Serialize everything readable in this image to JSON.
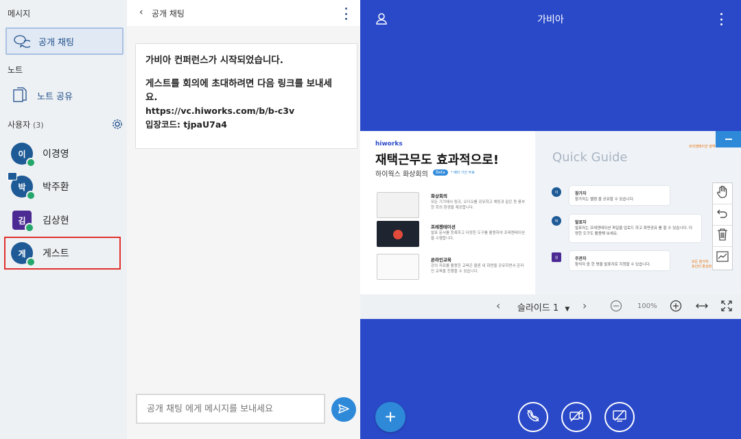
{
  "sidebar": {
    "messages_label": "메시지",
    "public_chat_label": "공개 채팅",
    "notes_label": "노트",
    "note_share_label": "노트 공유",
    "users_label": "사용자",
    "users_count": "(3)",
    "users": [
      {
        "initial": "이",
        "name": "이경영"
      },
      {
        "initial": "박",
        "name": "박주환"
      },
      {
        "initial": "김",
        "name": "김상현"
      },
      {
        "initial": "게",
        "name": "게스트"
      }
    ]
  },
  "chat": {
    "title": "공개 채팅",
    "message": {
      "line1": "가비아 컨퍼런스가 시작되었습니다.",
      "line2": "게스트를 회의에 초대하려면 다음 링크를 보내세",
      "line3": "요.",
      "link": "https://vc.hiworks.com/b/b-c3v",
      "code": "입장코드: tjpaU7a4"
    },
    "input_placeholder": "공개 채팅 에게 메시지를 보내세요"
  },
  "main": {
    "title": "가비아",
    "slide": {
      "brand": "hiworks",
      "title": "재택근무도 효과적으로!",
      "subtitle": "하이웍스 화상회의",
      "beta": "Beta",
      "beta_note": "* 베타 기간 무료",
      "features": [
        {
          "title": "화상회의",
          "desc": "모든 기기에서 링크, 오디오를 공유하고 채팅과 같은 등 풍부한 회의 환경을 제공합니다."
        },
        {
          "title": "프레젠테이션",
          "desc": "발표 문서를 등록하고 다양한 도구를 활용하여 프레젠테이션을 수행합니다."
        },
        {
          "title": "온라인교육",
          "desc": "강의 자료를 활용한 교육은 물론 내 화면을 공유하면서 온라인 교육을 진행할 수 있습니다."
        }
      ],
      "guide_title": "Quick Guide",
      "guide": [
        {
          "avatar": "이",
          "title": "참가자",
          "desc": "참가자는 웹캠 을 공유할 수 있습니다."
        },
        {
          "avatar": "박",
          "title": "발표자",
          "desc": "발표자는 프레젠테이션 파일을 업로드 하고 화면공유 를 할 수 있습니다. 다양한 도구도 활용해 보세요."
        },
        {
          "avatar": "김",
          "title": "주관자",
          "desc": "참석자 중 한 명을 발표자로 지정할 수 있습니다."
        }
      ],
      "note_top": "프리젠테이션 영역",
      "note_bottom": "모든 참가자\n포인터 활성화"
    },
    "slide_bar": {
      "slide_label": "슬라이드 1",
      "zoom": "100%"
    }
  },
  "colors": {
    "main_bg": "#2a49c9",
    "accent": "#2e89d9",
    "mic_green": "#24a76b",
    "selected_border": "#e0302b"
  }
}
